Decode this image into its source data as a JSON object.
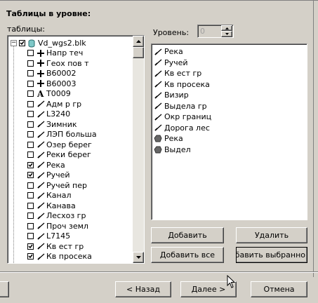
{
  "window": {
    "heading": "Таблицы в уровне:"
  },
  "left_panel": {
    "label": "таблицы:",
    "root": {
      "label": "Vd_wgs2.blk",
      "expanded": true
    },
    "items": [
      {
        "label": "Напр теч",
        "icon": "cross-icon",
        "checked": false
      },
      {
        "label": "Геох пов т",
        "icon": "cross-icon",
        "checked": false
      },
      {
        "label": "B60002",
        "icon": "cross-icon",
        "checked": false
      },
      {
        "label": "B60003",
        "icon": "cross-icon",
        "checked": false
      },
      {
        "label": "T0009",
        "icon": "text-a-icon",
        "checked": false
      },
      {
        "label": "Адм р гр",
        "icon": "line-icon",
        "checked": false
      },
      {
        "label": "L3240",
        "icon": "line-icon",
        "checked": false
      },
      {
        "label": "Зимник",
        "icon": "line-icon",
        "checked": false
      },
      {
        "label": "ЛЭП больша",
        "icon": "line-icon",
        "checked": false
      },
      {
        "label": "Озер берег",
        "icon": "line-icon",
        "checked": false
      },
      {
        "label": "Реки берег",
        "icon": "line-icon",
        "checked": false
      },
      {
        "label": "Река",
        "icon": "line-icon",
        "checked": true
      },
      {
        "label": "Ручей",
        "icon": "line-icon",
        "checked": true
      },
      {
        "label": "Ручей пер",
        "icon": "line-icon",
        "checked": false
      },
      {
        "label": "Канал",
        "icon": "line-icon",
        "checked": false
      },
      {
        "label": "Канава",
        "icon": "line-icon",
        "checked": false
      },
      {
        "label": "Лесхоз гр",
        "icon": "line-icon",
        "checked": false
      },
      {
        "label": "Проч земл",
        "icon": "line-icon",
        "checked": false
      },
      {
        "label": "L7145",
        "icon": "line-icon",
        "checked": false
      },
      {
        "label": "Кв ест гр",
        "icon": "line-icon",
        "checked": true
      },
      {
        "label": "Кв просека",
        "icon": "line-icon",
        "checked": true
      }
    ]
  },
  "level": {
    "label": "Уровень:",
    "value": "0"
  },
  "right_list": {
    "items": [
      {
        "label": "Река",
        "icon": "line-icon"
      },
      {
        "label": "Ручей",
        "icon": "line-icon"
      },
      {
        "label": "Кв ест гр",
        "icon": "line-icon"
      },
      {
        "label": "Кв просека",
        "icon": "line-icon"
      },
      {
        "label": "Визир",
        "icon": "line-icon"
      },
      {
        "label": "Выдела гр",
        "icon": "line-icon"
      },
      {
        "label": "Окр границ",
        "icon": "line-icon"
      },
      {
        "label": "Дорога лес",
        "icon": "line-icon"
      },
      {
        "label": "Река",
        "icon": "polygon-icon"
      },
      {
        "label": "Выдел",
        "icon": "polygon-icon"
      }
    ]
  },
  "buttons": {
    "add": "Добавить",
    "remove": "Удалить",
    "add_all": "Добавить все",
    "add_selected": "Добавить выбранно"
  },
  "footer": {
    "back": "< Назад",
    "next": "Далее >",
    "cancel": "Отмена"
  }
}
